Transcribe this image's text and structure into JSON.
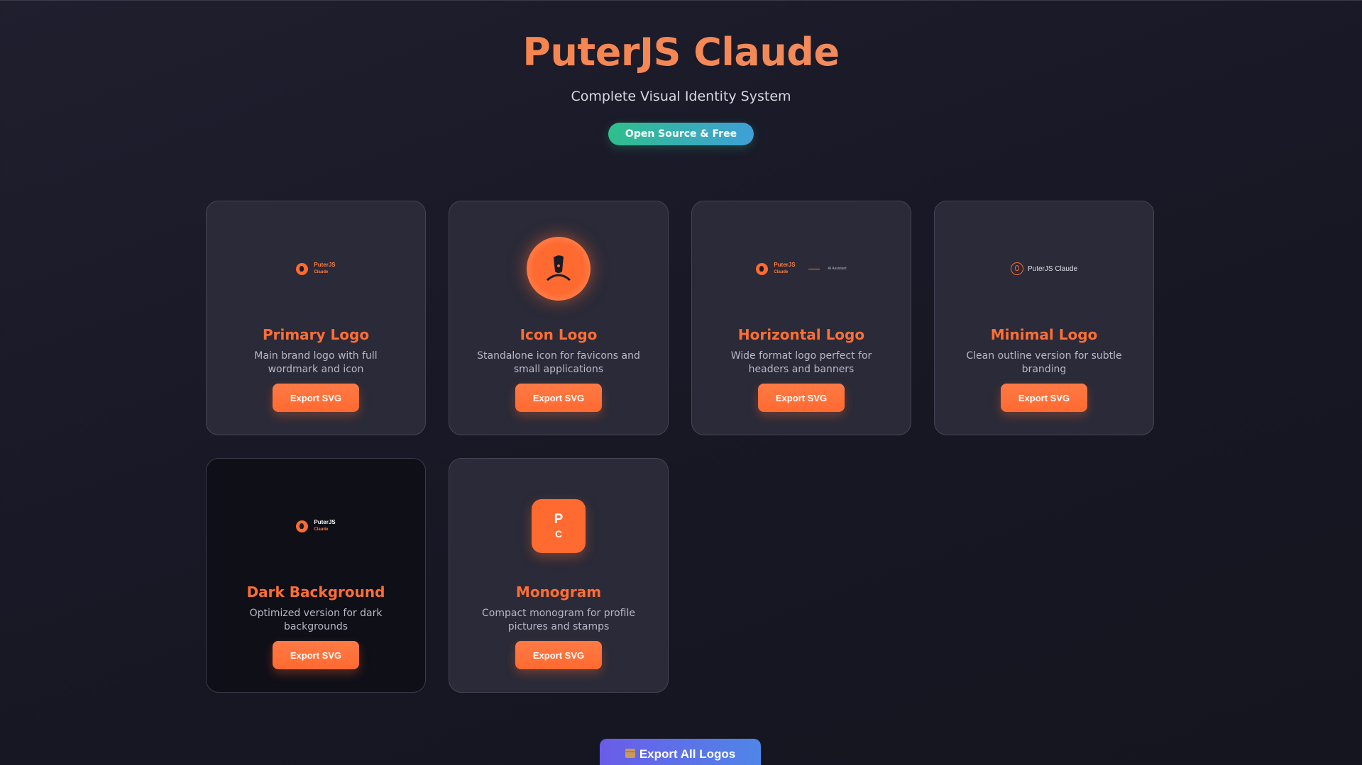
{
  "header": {
    "title": "PuterJS Claude",
    "subtitle": "Complete Visual Identity System",
    "badge": "Open Source & Free"
  },
  "cards": [
    {
      "title": "Primary Logo",
      "description": "Main brand logo with full wordmark and icon",
      "button": "Export SVG",
      "logo": {
        "line1": "PuterJS",
        "line2": "Claude"
      }
    },
    {
      "title": "Icon Logo",
      "description": "Standalone icon for favicons and small applications",
      "button": "Export SVG"
    },
    {
      "title": "Horizontal Logo",
      "description": "Wide format logo perfect for headers and banners",
      "button": "Export SVG",
      "logo": {
        "line1": "PuterJS",
        "line2": "Claude",
        "tagline": "AI Assistant"
      }
    },
    {
      "title": "Minimal Logo",
      "description": "Clean outline version for subtle branding",
      "button": "Export SVG",
      "logo": {
        "text": "PuterJS Claude"
      }
    },
    {
      "title": "Dark Background",
      "description": "Optimized version for dark backgrounds",
      "button": "Export SVG",
      "logo": {
        "line1": "PuterJS",
        "line2": "Claude"
      }
    },
    {
      "title": "Monogram",
      "description": "Compact monogram for profile pictures and stamps",
      "button": "Export SVG",
      "logo": {
        "letter1": "P",
        "letter2": "C"
      }
    }
  ],
  "export_all": {
    "label": "Export All Logos",
    "icon": "package-icon"
  },
  "colors": {
    "brand_orange": "#ff6a30",
    "badge_gradient": [
      "#2fbf8c",
      "#3f9fd8"
    ],
    "export_all_gradient": [
      "#6a5ce8",
      "#4f86e8"
    ],
    "background": "#181826"
  }
}
